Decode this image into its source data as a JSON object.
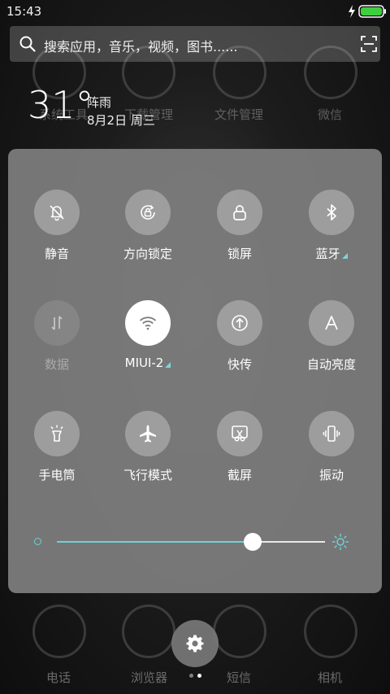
{
  "status_bar": {
    "time": "15:43",
    "battery_color": "#3ecf3e"
  },
  "search": {
    "placeholder": "搜索应用，音乐，视频，图书......"
  },
  "weather": {
    "temperature": "31°",
    "condition": "阵雨",
    "date": "8月2日 周三"
  },
  "background_apps": [
    {
      "label": "系统工具",
      "icon": "tools-folder-icon"
    },
    {
      "label": "下载管理",
      "icon": "download-icon"
    },
    {
      "label": "文件管理",
      "icon": "folder-icon"
    },
    {
      "label": "微信",
      "icon": "wechat-icon"
    }
  ],
  "quick_settings": [
    {
      "label": "静音",
      "icon": "mute-bell-icon",
      "state": "off"
    },
    {
      "label": "方向锁定",
      "icon": "rotation-lock-icon",
      "state": "off"
    },
    {
      "label": "锁屏",
      "icon": "lock-icon",
      "state": "off"
    },
    {
      "label": "蓝牙",
      "icon": "bluetooth-icon",
      "state": "off",
      "expandable": true
    },
    {
      "label": "数据",
      "icon": "mobile-data-icon",
      "state": "disabled"
    },
    {
      "label": "MIUI-2",
      "icon": "wifi-icon",
      "state": "on",
      "expandable": true
    },
    {
      "label": "快传",
      "icon": "quick-transfer-icon",
      "state": "off"
    },
    {
      "label": "自动亮度",
      "icon": "auto-brightness-icon",
      "state": "off"
    },
    {
      "label": "手电筒",
      "icon": "flashlight-icon",
      "state": "off"
    },
    {
      "label": "飞行模式",
      "icon": "airplane-icon",
      "state": "off"
    },
    {
      "label": "截屏",
      "icon": "screenshot-icon",
      "state": "off"
    },
    {
      "label": "振动",
      "icon": "vibrate-icon",
      "state": "off"
    }
  ],
  "brightness": {
    "level": 0.73,
    "accent_color": "#6fd0d4"
  },
  "dock": [
    {
      "label": "电话",
      "icon": "phone-icon"
    },
    {
      "label": "浏览器",
      "icon": "browser-icon"
    },
    {
      "label": "短信",
      "icon": "sms-icon"
    },
    {
      "label": "相机",
      "icon": "camera-icon"
    }
  ],
  "pager": {
    "count": 2,
    "active": 1
  },
  "settings_icon": "gear-icon"
}
